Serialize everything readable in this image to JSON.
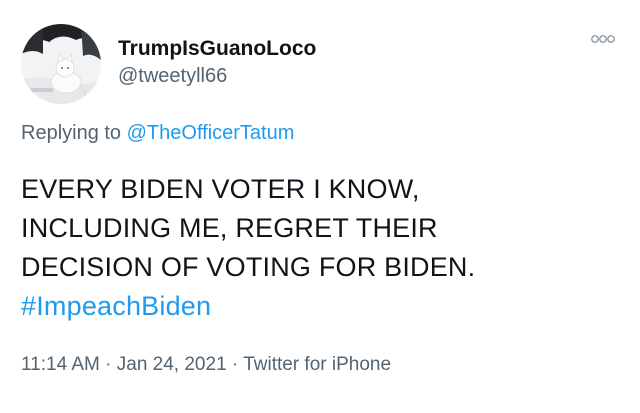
{
  "user": {
    "display_name": "TrumpIsGuanoLoco",
    "handle": "@tweetyll66",
    "avatar_icon": "snow-cat-avatar"
  },
  "more_icon": "more-options-icon",
  "reply": {
    "prefix": "Replying to ",
    "mention": "@TheOfficerTatum"
  },
  "tweet": {
    "lines": [
      "EVERY BIDEN VOTER I KNOW,",
      "INCLUDING ME, REGRET THEIR",
      "DECISION OF VOTING FOR BIDEN."
    ],
    "hashtag": "#ImpeachBiden"
  },
  "meta": {
    "time": "11:14 AM",
    "separator": " · ",
    "date": "Jan 24, 2021",
    "source": "Twitter for iPhone"
  },
  "colors": {
    "link": "#1d9bf0",
    "secondary_text": "#536471",
    "primary_text": "#0f1419"
  }
}
